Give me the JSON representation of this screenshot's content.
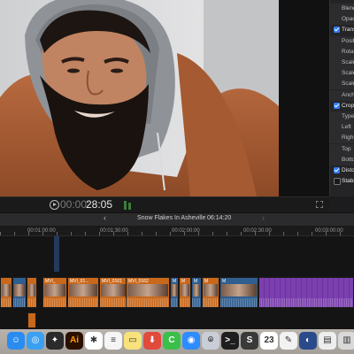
{
  "inspector": {
    "rows": [
      {
        "label": "Blend",
        "type": "sub"
      },
      {
        "label": "Opac",
        "type": "sub"
      },
      {
        "label": "Transf",
        "type": "head",
        "checked": true
      },
      {
        "label": "Positi",
        "type": "sub"
      },
      {
        "label": "Rotati",
        "type": "sub"
      },
      {
        "label": "Scale",
        "type": "sub"
      },
      {
        "label": "Scale",
        "type": "sub"
      },
      {
        "label": "Scale",
        "type": "sub"
      },
      {
        "label": "Anch",
        "type": "sub"
      },
      {
        "label": "Crop",
        "type": "head",
        "checked": true
      },
      {
        "label": "Type",
        "type": "sub"
      },
      {
        "label": "Left",
        "type": "sub"
      },
      {
        "label": "Right",
        "type": "sub"
      },
      {
        "label": "Top",
        "type": "sub"
      },
      {
        "label": "Botto",
        "type": "sub"
      },
      {
        "label": "Distor",
        "type": "head",
        "checked": true
      },
      {
        "label": "Stabi",
        "type": "head",
        "checked": false
      }
    ]
  },
  "viewer": {
    "timecode_dim": "00:00:",
    "timecode": "28:05",
    "play_icon": "play-icon",
    "fullscreen_icon": "fullscreen-icon"
  },
  "timeline": {
    "project_name": "Snow Flakes In Asheville",
    "duration": "06:14:20",
    "back_glyph": "‹",
    "forward_glyph": "›",
    "ruler": [
      "00:01:00:00",
      "00:01:30:00",
      "00:02:00:00",
      "00:02:30:00",
      "00:03:00:00"
    ],
    "clips": [
      {
        "label": "",
        "color": "#c9681b"
      },
      {
        "label": "",
        "color": "#2f5e8f"
      },
      {
        "label": "",
        "color": "#c9681b"
      },
      {
        "label": "MVI_",
        "color": "#c9681b"
      },
      {
        "label": "MVI_01...",
        "color": "#c9681b"
      },
      {
        "label": "MVI_0161",
        "color": "#c9681b"
      },
      {
        "label": "MVI_0162",
        "color": "#c9681b"
      },
      {
        "label": "M",
        "color": "#2f5e8f"
      },
      {
        "label": "M",
        "color": "#c9681b"
      },
      {
        "label": "M",
        "color": "#2f5e8f"
      },
      {
        "label": "M",
        "color": "#c9681b"
      },
      {
        "label": "M",
        "color": "#2f5e8f"
      },
      {
        "label": "",
        "color": "#7b3fb0"
      }
    ]
  },
  "dock": {
    "items": [
      {
        "name": "finder-icon",
        "glyph": "☺",
        "bg": "#2a8cf0"
      },
      {
        "name": "safari-icon",
        "glyph": "◎",
        "bg": "#3aa0f2"
      },
      {
        "name": "final-cut-icon",
        "glyph": "✦",
        "bg": "#2b2b2b"
      },
      {
        "name": "illustrator-icon",
        "glyph": "Ai",
        "bg": "#2b1000"
      },
      {
        "name": "slack-icon",
        "glyph": "✱",
        "bg": "#ffffff"
      },
      {
        "name": "notes-icon",
        "glyph": "≡",
        "bg": "#f5f5f5"
      },
      {
        "name": "stickies-icon",
        "glyph": "▭",
        "bg": "#f7e27b"
      },
      {
        "name": "download-icon",
        "glyph": "⬇",
        "bg": "#e24a3b"
      },
      {
        "name": "app-c-icon",
        "glyph": "C",
        "bg": "#3bbf4a"
      },
      {
        "name": "zoom-icon",
        "glyph": "◉",
        "bg": "#2d8cff"
      },
      {
        "name": "preview-icon",
        "glyph": "⌾",
        "bg": "#c9ced6"
      },
      {
        "name": "terminal-icon",
        "glyph": ">_",
        "bg": "#1e1e1e"
      },
      {
        "name": "sublime-icon",
        "glyph": "S",
        "bg": "#3a3a3a"
      },
      {
        "name": "calendar-icon",
        "glyph": "23",
        "bg": "#ffffff"
      },
      {
        "name": "textedit-icon",
        "glyph": "✎",
        "bg": "#f2f2f2"
      },
      {
        "name": "browser-icon",
        "glyph": "◐",
        "bg": "#2b4a8a"
      },
      {
        "name": "document-icon",
        "glyph": "▤",
        "bg": "#eeeeee"
      },
      {
        "name": "trash-icon",
        "glyph": "▥",
        "bg": "#d9d9d9"
      }
    ]
  }
}
